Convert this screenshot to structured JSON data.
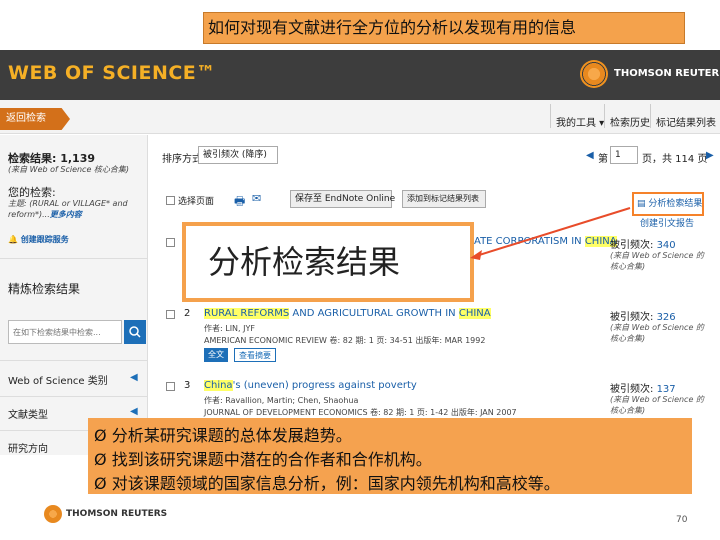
{
  "slide": {
    "title": "如何对现有文献进行全方位的分析以发现有用的信息",
    "callout": "分析检索结果",
    "bullets": [
      "分析某研究课题的总体发展趋势。",
      "找到该研究课题中潜在的合作者和合作机构。",
      "对该课题领域的国家信息分析，例：国家内领先机构和高校等。"
    ],
    "bullet_marker": "Ø",
    "footer_brand": "THOMSON REUTERS",
    "page_number": "70"
  },
  "header": {
    "logo": "WEB OF SCIENCE™",
    "brand": "THOMSON REUTERS"
  },
  "nav": {
    "back": "返回检索",
    "tools": "我的工具 ▾",
    "history": "检索历史",
    "marked": "标记结果列表"
  },
  "sidebar": {
    "results_label": "检索结果: 1,139",
    "results_source": "(来自 Web of Science 核心合集)",
    "query_label": "您的检索:",
    "query_text": "主题: (RURAL or VILLAGE* and reform*)...",
    "more": "更多内容",
    "alert": "创建跟踪服务",
    "refine_title": "精炼检索结果",
    "refine_placeholder": "在如下检索结果中检索...",
    "facets": [
      "Web of Science 类别",
      "文献类型",
      "研究方向"
    ]
  },
  "toolbar": {
    "sort_label": "排序方式",
    "sort_value": "被引频次 (降序)",
    "page_label": "第",
    "page_value": "1",
    "page_total": "页，共 114 页",
    "select_page": "选择页面",
    "save_to": "保存至 EndNote Online",
    "add_marked": "添加到标记结果列表",
    "analyze": "分析检索结果",
    "citation_report": "创建引文报告"
  },
  "results": [
    {
      "num": "1",
      "title_tail": "ATE CORPORATISM IN ",
      "title_hl": "CHINA",
      "cite_label": "被引频次: ",
      "cite_count": "340",
      "cite_source": "(来自 Web of Science 的核心合集)"
    },
    {
      "num": "2",
      "title_hl1": "RURAL REFORMS",
      "title_mid": " AND AGRICULTURAL GROWTH IN ",
      "title_hl2": "CHINA",
      "authors": "作者: LIN, JYF",
      "journal": "AMERICAN ECONOMIC REVIEW 卷: 82 期: 1 页: 34-51 出版年: MAR 1992",
      "btn_full": "全文",
      "btn_view": "查看摘要",
      "cite_label": "被引频次: ",
      "cite_count": "326",
      "cite_source": "(来自 Web of Science 的核心合集)"
    },
    {
      "num": "3",
      "title_hl": "China",
      "title_tail": "'s (uneven) progress against poverty",
      "authors": "作者: Ravallion, Martin; Chen, Shaohua",
      "journal": "JOURNAL OF DEVELOPMENT ECONOMICS 卷: 82 期: 1 页: 1-42 出版年: JAN 2007",
      "cite_label": "被引频次: ",
      "cite_count": "137",
      "cite_source": "(来自 Web of Science 的核心合集)"
    }
  ],
  "colors": {
    "accent_orange": "#f5a24f",
    "header_dark": "#3d3d3d",
    "wos_gold": "#f5b026",
    "link_blue": "#1a5fa8"
  }
}
